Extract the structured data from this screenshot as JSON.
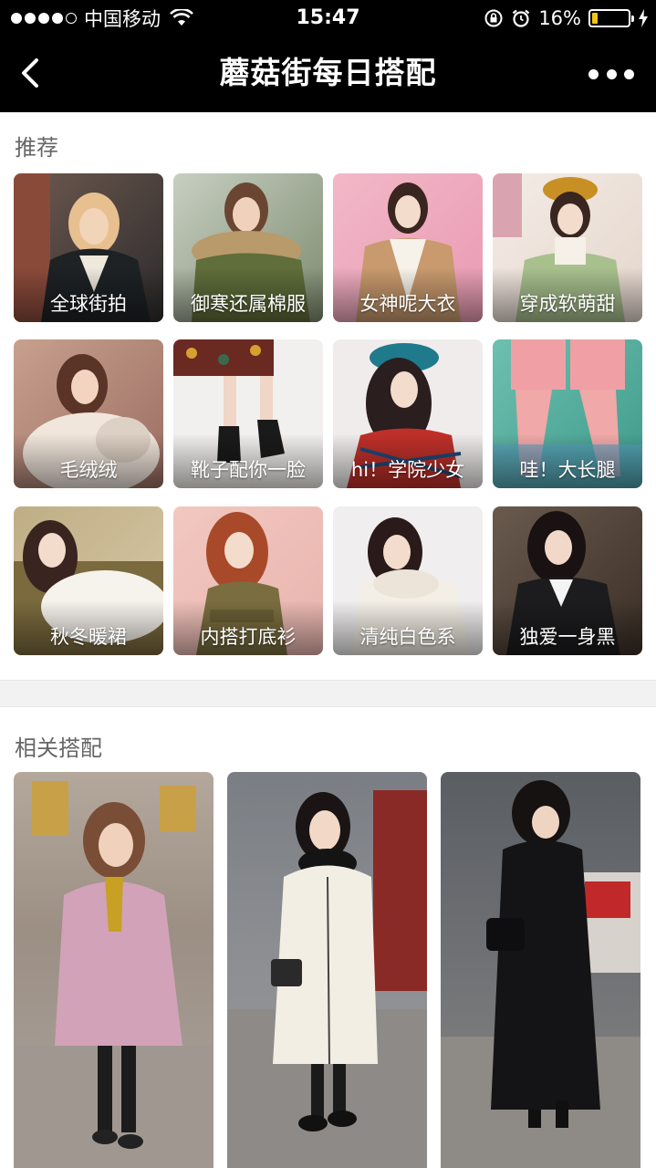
{
  "status_bar": {
    "carrier": "中国移动",
    "time": "15:47",
    "battery_percent": "16%",
    "battery_level": 0.16,
    "battery_color": "#f5c518"
  },
  "navbar": {
    "title": "蘑菇街每日搭配",
    "back_icon": "chevron-left-icon",
    "more_icon": "more-dots-icon"
  },
  "recommend": {
    "title": "推荐",
    "items": [
      {
        "label": "全球街拍"
      },
      {
        "label": "御寒还属棉服"
      },
      {
        "label": "女神呢大衣"
      },
      {
        "label": "穿成软萌甜"
      },
      {
        "label": "毛绒绒"
      },
      {
        "label": "靴子配你一脸"
      },
      {
        "label": "hi！学院少女"
      },
      {
        "label": "哇！大长腿"
      },
      {
        "label": "秋冬暖裙"
      },
      {
        "label": "内搭打底衫"
      },
      {
        "label": "清纯白色系"
      },
      {
        "label": "独爱一身黑"
      }
    ]
  },
  "related": {
    "title": "相关搭配"
  }
}
